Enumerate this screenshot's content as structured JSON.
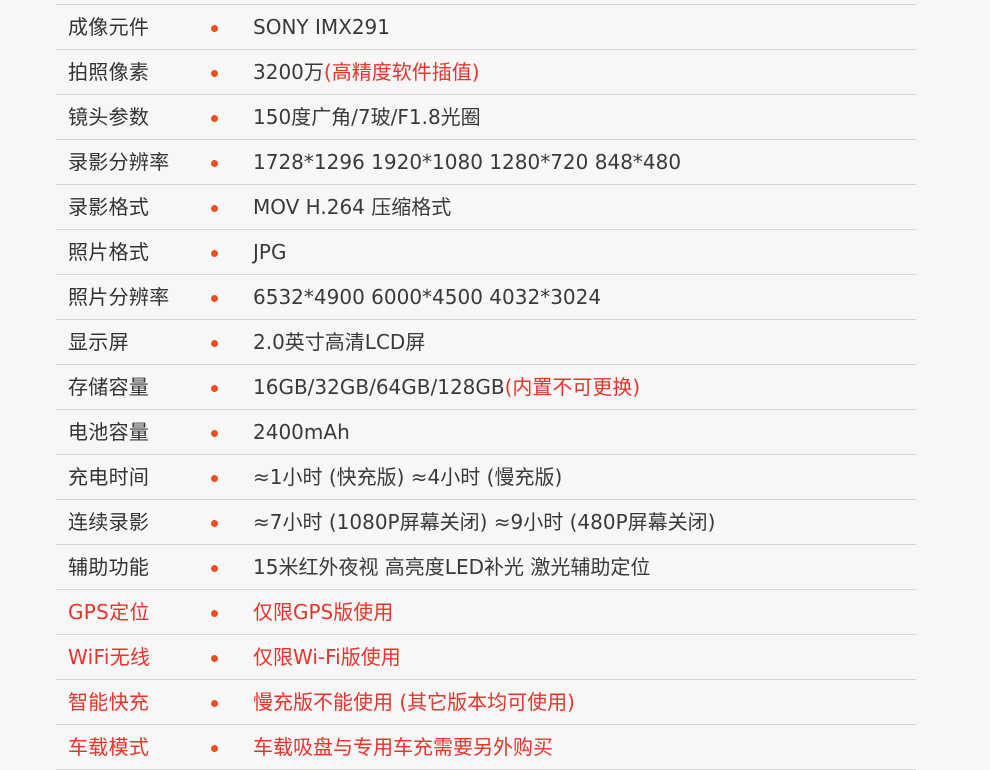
{
  "specs": [
    {
      "label": "成像元件",
      "value": "SONY IMX291",
      "note": "",
      "red": false
    },
    {
      "label": "拍照像素",
      "value": "3200万",
      "note": "(高精度软件插值)",
      "red": false
    },
    {
      "label": "镜头参数",
      "value": "150度广角/7玻/F1.8光圈",
      "note": "",
      "red": false
    },
    {
      "label": "录影分辨率",
      "value": "1728*1296 1920*1080 1280*720 848*480",
      "note": "",
      "red": false
    },
    {
      "label": "录影格式",
      "value": "MOV H.264 压缩格式",
      "note": "",
      "red": false
    },
    {
      "label": "照片格式",
      "value": "JPG",
      "note": "",
      "red": false
    },
    {
      "label": "照片分辨率",
      "value": "6532*4900 6000*4500  4032*3024",
      "note": "",
      "red": false
    },
    {
      "label": "显示屏",
      "value": "2.0英寸高清LCD屏",
      "note": "",
      "red": false
    },
    {
      "label": "存储容量",
      "value": "16GB/32GB/64GB/128GB",
      "note": "(内置不可更换)",
      "red": false
    },
    {
      "label": "电池容量",
      "value": "2400mAh",
      "note": "",
      "red": false
    },
    {
      "label": "充电时间",
      "value": "≈1小时 (快充版)  ≈4小时 (慢充版)",
      "note": "",
      "red": false
    },
    {
      "label": "连续录影",
      "value": "≈7小时 (1080P屏幕关闭)  ≈9小时 (480P屏幕关闭)",
      "note": "",
      "red": false
    },
    {
      "label": "辅助功能",
      "value": "15米红外夜视  高亮度LED补光  激光辅助定位",
      "note": "",
      "red": false
    },
    {
      "label": "GPS定位",
      "value": "仅限GPS版使用",
      "note": "",
      "red": true
    },
    {
      "label": "WiFi无线",
      "value": "仅限Wi-Fi版使用",
      "note": "",
      "red": true
    },
    {
      "label": "智能快充",
      "value": "慢充版不能使用 (其它版本均可使用)",
      "note": "",
      "red": true
    },
    {
      "label": "车载模式",
      "value": "车载吸盘与专用车充需要另外购买",
      "note": "",
      "red": true
    }
  ],
  "colors": {
    "bullet": "#ee4e1f",
    "highlight": "#e8342b",
    "text": "#3a3a3a",
    "divider": "#d6d6d6",
    "background": "#f7f7f7"
  }
}
